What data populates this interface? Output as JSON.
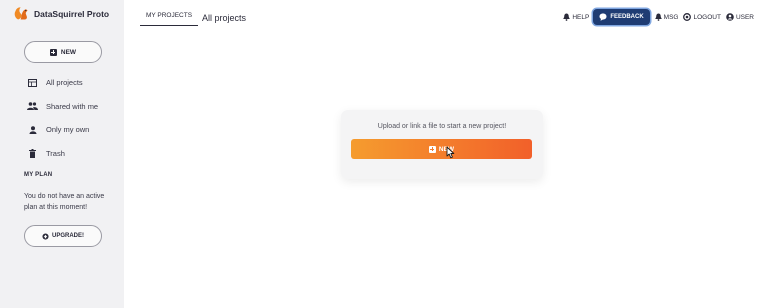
{
  "app": {
    "name": "DataSquirrel Proto",
    "logo_icon": "squirrel-logo"
  },
  "sidebar": {
    "new_button": "NEW",
    "items": [
      {
        "label": "All projects",
        "icon": "grid-icon"
      },
      {
        "label": "Shared with me",
        "icon": "users-icon"
      },
      {
        "label": "Only my own",
        "icon": "user-icon"
      },
      {
        "label": "Trash",
        "icon": "trash-icon"
      }
    ],
    "plan": {
      "title": "MY PLAN",
      "text": "You do not have an active plan at this moment!",
      "upgrade_button": "UPGRADE!"
    }
  },
  "header": {
    "tab_active": "MY PROJECTS",
    "page_title": "All projects"
  },
  "topnav": {
    "help": "HELP",
    "feedback": "FEEDBACK",
    "msg": "MSG",
    "logout": "LOGOUT",
    "user": "USER"
  },
  "main": {
    "upload_text": "Upload or link a file to start a new project!",
    "upload_button": "NEW"
  },
  "colors": {
    "sidebar_bg": "#f1f1f3",
    "feedback_bg": "#1f3c73",
    "accent_start": "#f59c2e",
    "accent_end": "#f2602a",
    "logo_orange": "#f08a24"
  }
}
